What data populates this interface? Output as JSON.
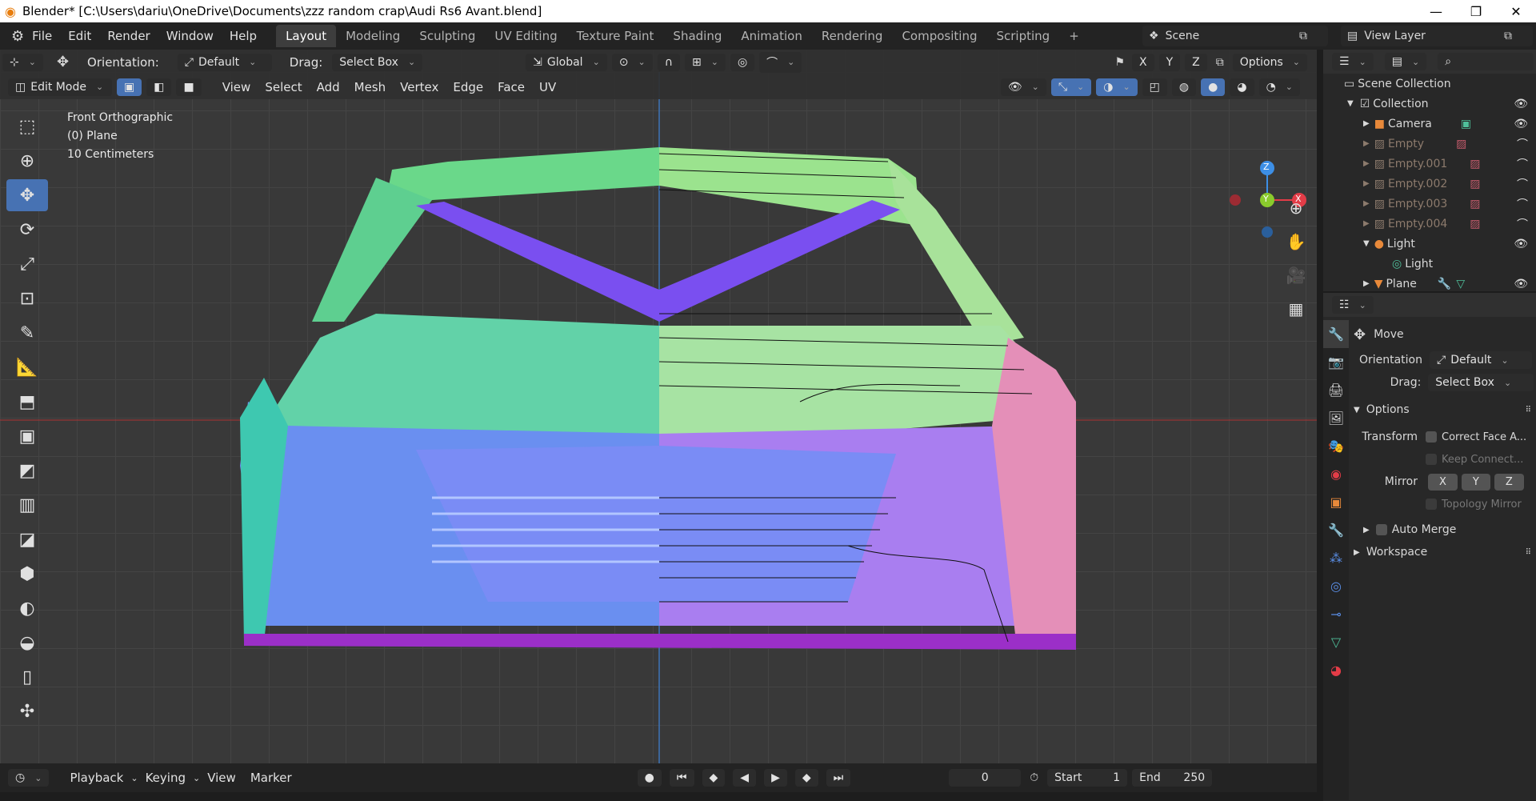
{
  "window": {
    "title": "Blender* [C:\\Users\\dariu\\OneDrive\\Documents\\zzz random crap\\Audi Rs6 Avant.blend]",
    "minimize": "—",
    "maximize": "❐",
    "close": "✕"
  },
  "menu": [
    "File",
    "Edit",
    "Render",
    "Window",
    "Help"
  ],
  "workspaces": [
    "Layout",
    "Modeling",
    "Sculpting",
    "UV Editing",
    "Texture Paint",
    "Shading",
    "Animation",
    "Rendering",
    "Compositing",
    "Scripting"
  ],
  "add_workspace": "+",
  "scene": "Scene",
  "view_layer": "View Layer",
  "tool_header": {
    "orientation_label": "Orientation:",
    "orientation_value": "Default",
    "drag_label": "Drag:",
    "drag_value": "Select Box",
    "transform_orientation": "Global",
    "options": "Options",
    "axes": [
      "X",
      "Y",
      "Z"
    ]
  },
  "mode_header": {
    "mode": "Edit Mode",
    "menus": [
      "View",
      "Select",
      "Add",
      "Mesh",
      "Vertex",
      "Edge",
      "Face",
      "UV"
    ]
  },
  "overlay": {
    "view": "Front Orthographic",
    "object": "(0) Plane",
    "scale": "10 Centimeters"
  },
  "gizmo": {
    "z": "Z",
    "y": "Y",
    "x": "X"
  },
  "timeline": {
    "playback": "Playback",
    "keying": "Keying",
    "view": "View",
    "marker": "Marker",
    "current_frame": "0",
    "start_label": "Start",
    "start": "1",
    "end_label": "End",
    "end": "250"
  },
  "outliner": {
    "root": "Scene Collection",
    "items": [
      {
        "name": "Collection",
        "indent": 0
      },
      {
        "name": "Camera",
        "indent": 1
      },
      {
        "name": "Empty",
        "indent": 1
      },
      {
        "name": "Empty.001",
        "indent": 1
      },
      {
        "name": "Empty.002",
        "indent": 1
      },
      {
        "name": "Empty.003",
        "indent": 1
      },
      {
        "name": "Empty.004",
        "indent": 1
      },
      {
        "name": "Light",
        "indent": 1
      },
      {
        "name": "Light",
        "indent": 2
      },
      {
        "name": "Plane",
        "indent": 1
      }
    ]
  },
  "properties": {
    "operator": "Move",
    "orientation_label": "Orientation",
    "orientation_value": "Default",
    "drag_label": "Drag:",
    "drag_value": "Select Box",
    "options_panel": "Options",
    "transform_label": "Transform",
    "correct_face": "Correct Face A...",
    "keep_connected": "Keep Connect...",
    "mirror_label": "Mirror",
    "mirror_axes": [
      "X",
      "Y",
      "Z"
    ],
    "topology_mirror": "Topology Mirror",
    "auto_merge": "Auto Merge",
    "workspace_panel": "Workspace"
  },
  "colors": {
    "accent": "#4772b3",
    "x_axis": "#e33c47",
    "y_axis": "#8acb2c",
    "z_axis": "#3d8fe6"
  }
}
